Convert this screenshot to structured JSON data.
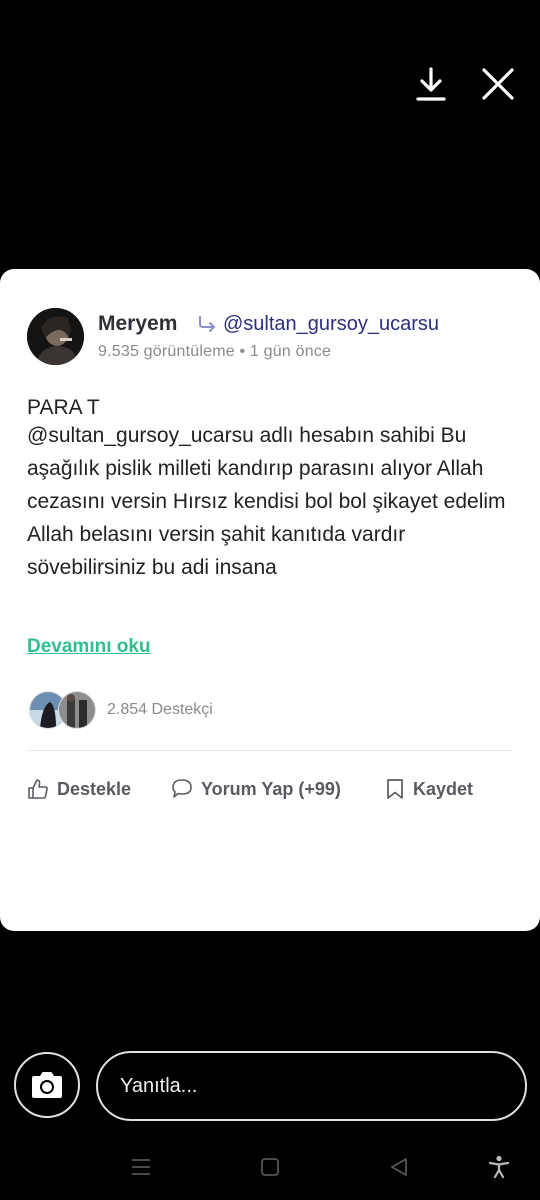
{
  "post": {
    "author": "Meryem",
    "recipient": "@sultan_gursoy_ucarsu",
    "meta": "9.535 görüntüleme • 1 gün önce",
    "title": "PARA T",
    "body": "@sultan_gursoy_ucarsu adlı hesabın sahibi  Bu aşağılık pislik  milleti kandırıp parasını alıyor Allah cezasını versin Hırsız kendisi bol bol şikayet edelim Allah belasını versin şahit kanıtıda vardır sövebilirsiniz bu adi insana",
    "read_more": "Devamını oku",
    "supporters": "2.854 Destekçi"
  },
  "actions": {
    "support": "Destekle",
    "comment": "Yorum Yap (+99)",
    "save": "Kaydet"
  },
  "reply": {
    "placeholder": "Yanıtla..."
  },
  "colors": {
    "background": "#000000",
    "card": "#ffffff",
    "handle": "#2a2f7e",
    "read_more": "#2fbf8f",
    "muted": "#8a8a8f"
  },
  "icons": [
    "download-icon",
    "close-icon",
    "share-arrow-icon",
    "thumbs-up-icon",
    "comment-icon",
    "bookmark-icon",
    "camera-icon",
    "menu-icon",
    "home-square-icon",
    "back-triangle-icon",
    "accessibility-icon"
  ]
}
